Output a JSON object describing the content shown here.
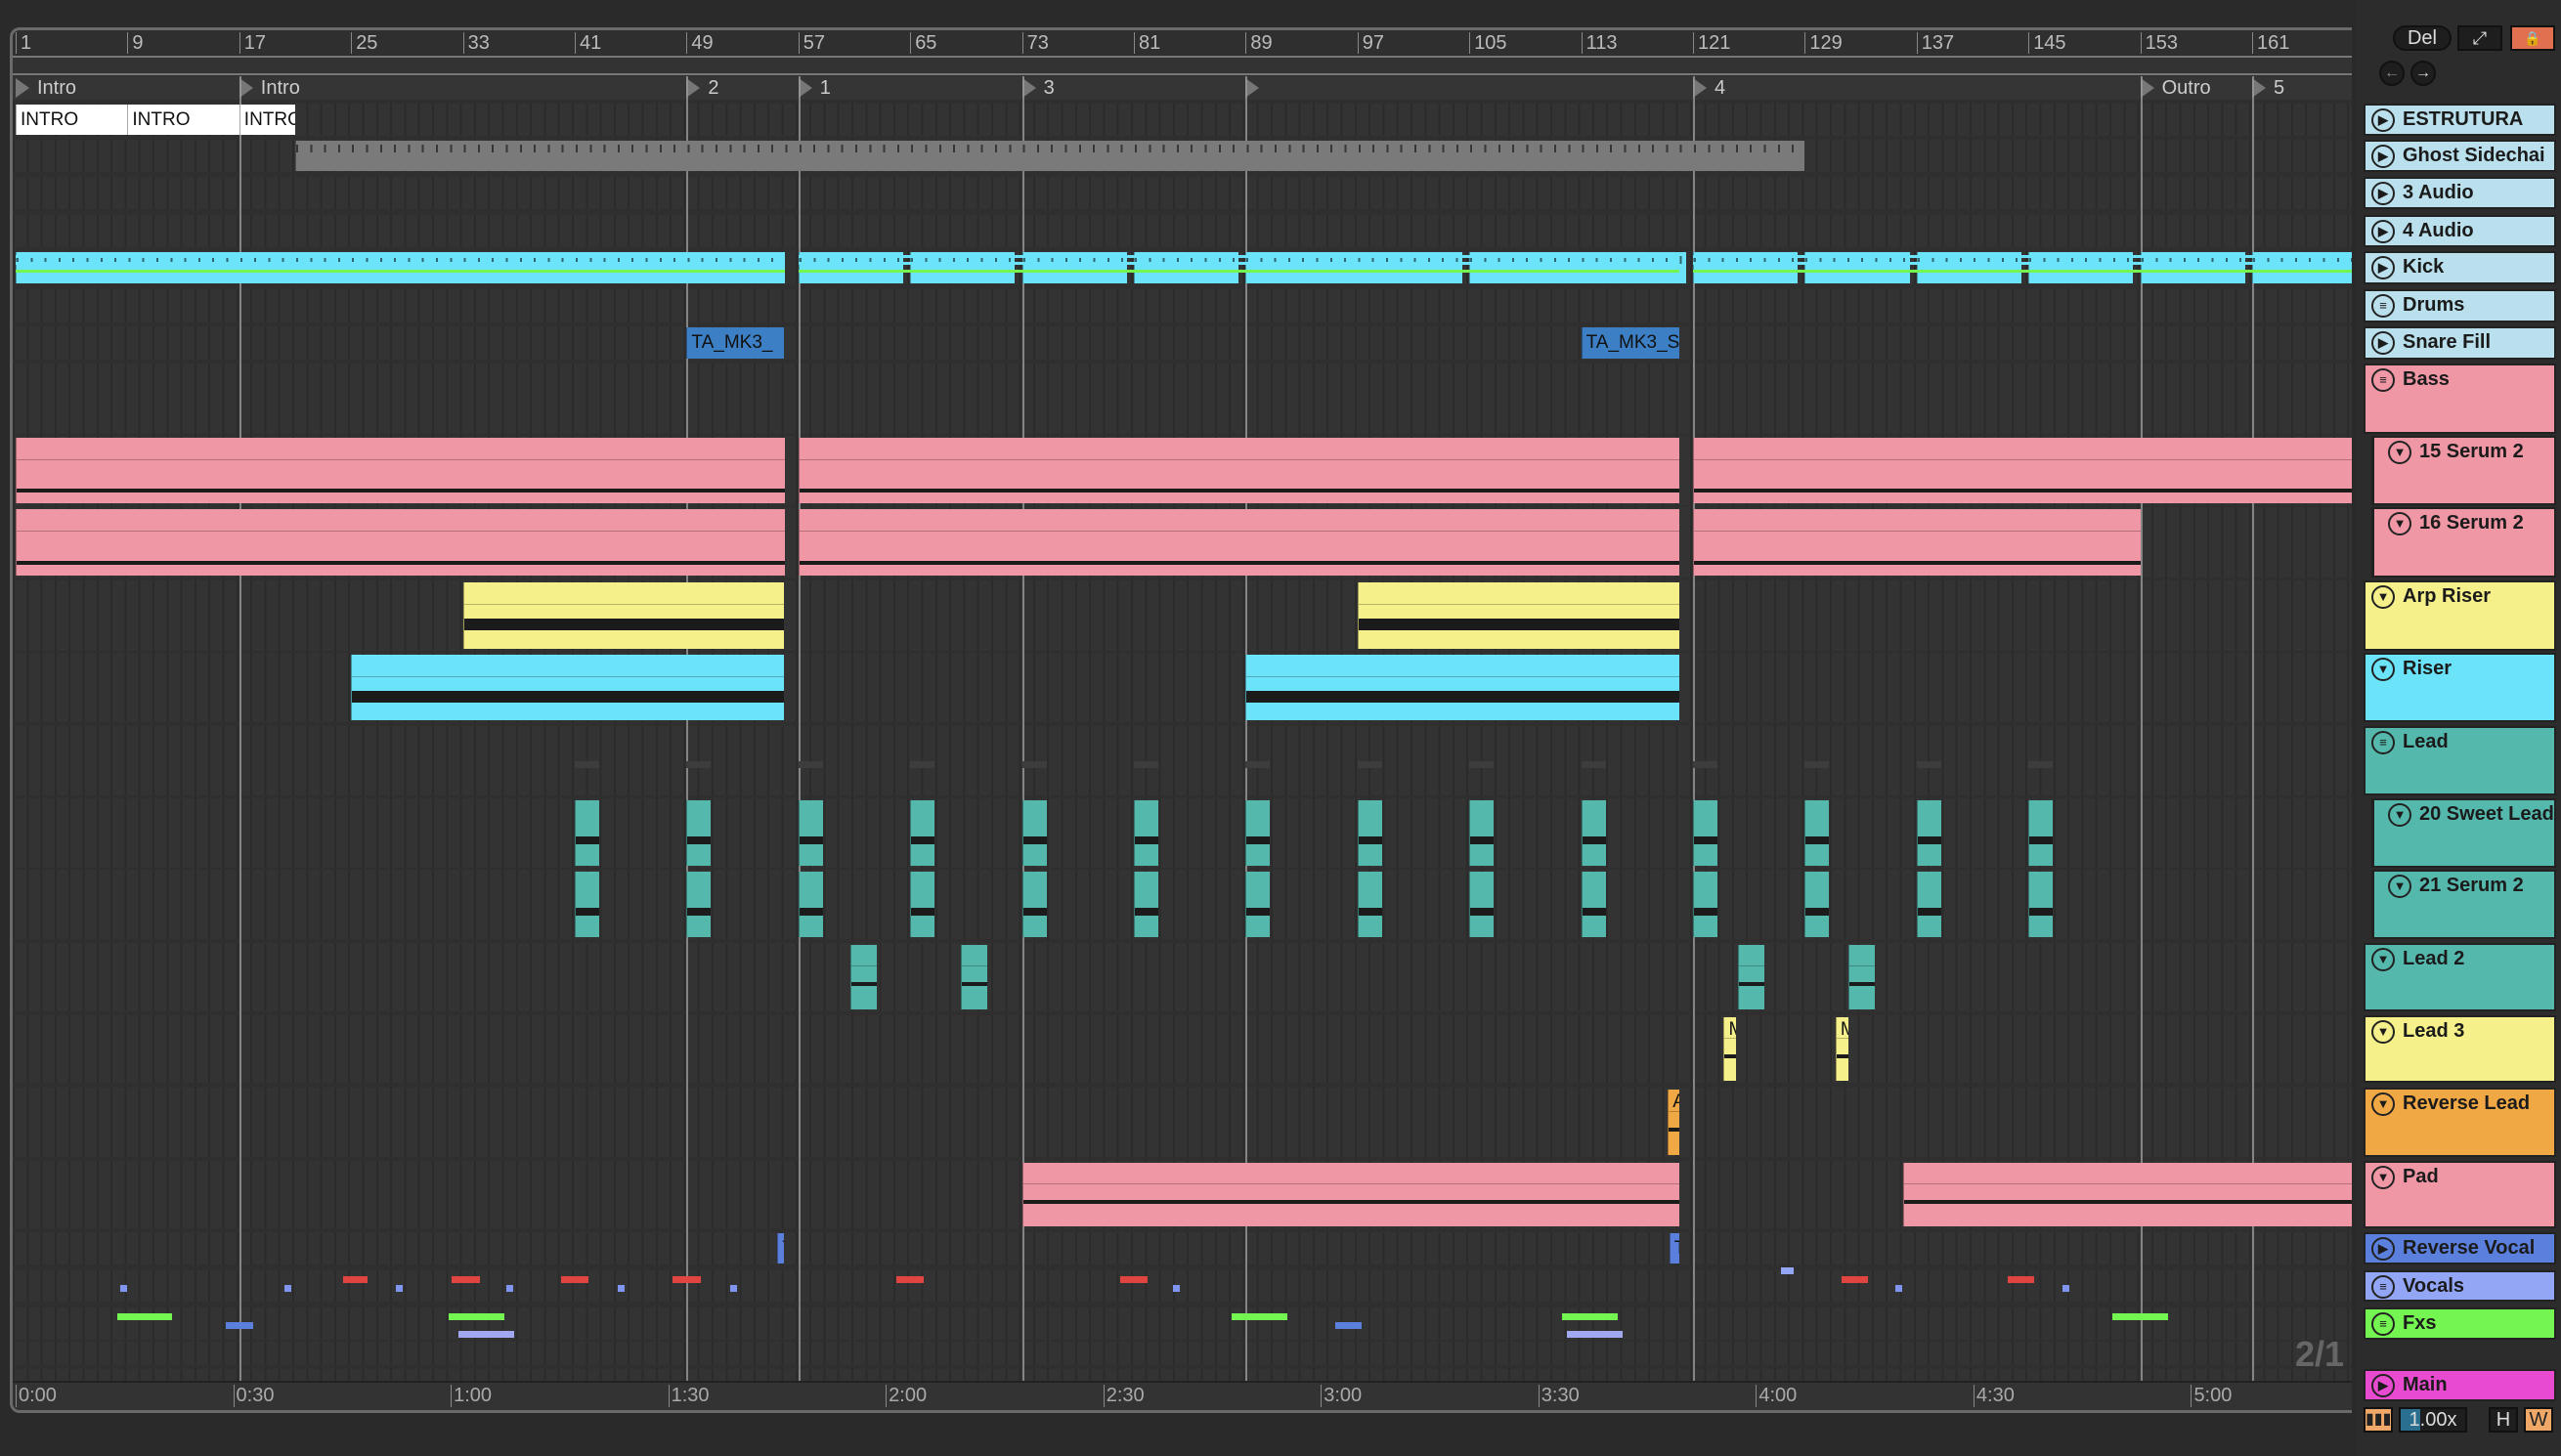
{
  "ruler": {
    "bars": [
      "1",
      "9",
      "17",
      "25",
      "33",
      "41",
      "49",
      "57",
      "65",
      "73",
      "81",
      "89",
      "97",
      "105",
      "113",
      "121",
      "129",
      "137",
      "145",
      "153",
      "161"
    ]
  },
  "locators": [
    {
      "label": "Intro",
      "bar": 1
    },
    {
      "label": "Intro",
      "bar": 17
    },
    {
      "label": "2",
      "bar": 49
    },
    {
      "label": "1",
      "bar": 57
    },
    {
      "label": "3",
      "bar": 73
    },
    {
      "label": "",
      "bar": 89
    },
    {
      "label": "4",
      "bar": 121
    },
    {
      "label": "Outro",
      "bar": 153
    },
    {
      "label": "5",
      "bar": 161
    }
  ],
  "tracks": [
    {
      "name": "ESTRUTURA",
      "color": "#b9e0ec",
      "icon": "play"
    },
    {
      "name": "Ghost Sidechai",
      "color": "#b9e0ec",
      "icon": "play"
    },
    {
      "name": "3 Audio",
      "color": "#b9e0ec",
      "icon": "play"
    },
    {
      "name": "4 Audio",
      "color": "#b9e0ec",
      "icon": "play"
    },
    {
      "name": "Kick",
      "color": "#b9e0ec",
      "icon": "play"
    },
    {
      "name": "Drums",
      "color": "#b9e0ec",
      "icon": "list"
    },
    {
      "name": "Snare Fill",
      "color": "#b9e0ec",
      "icon": "play"
    },
    {
      "name": "Bass",
      "color": "#f097a6",
      "icon": "group"
    },
    {
      "name": "15 Serum 2",
      "color": "#f097a6",
      "icon": "fold",
      "sub": true
    },
    {
      "name": "16 Serum 2",
      "color": "#f097a6",
      "icon": "fold",
      "sub": true
    },
    {
      "name": "Arp Riser",
      "color": "#f5f08a",
      "icon": "fold"
    },
    {
      "name": "Riser",
      "color": "#6be3f9",
      "icon": "fold"
    },
    {
      "name": "Lead",
      "color": "#55b8ad",
      "icon": "group"
    },
    {
      "name": "20 Sweet Lead",
      "color": "#55b8ad",
      "icon": "fold",
      "sub": true
    },
    {
      "name": "21 Serum 2",
      "color": "#55b8ad",
      "icon": "fold",
      "sub": true
    },
    {
      "name": "Lead 2",
      "color": "#55b8ad",
      "icon": "fold"
    },
    {
      "name": "Lead 3",
      "color": "#f5f08a",
      "icon": "fold"
    },
    {
      "name": "Reverse Lead",
      "color": "#f0a845",
      "icon": "fold"
    },
    {
      "name": "Pad",
      "color": "#f097a6",
      "icon": "fold"
    },
    {
      "name": "Reverse Vocal",
      "color": "#5b7fdc",
      "icon": "play"
    },
    {
      "name": "Vocals",
      "color": "#93a5f5",
      "icon": "list"
    },
    {
      "name": "Fxs",
      "color": "#75f552",
      "icon": "list"
    },
    {
      "name": "Main",
      "color": "#e84bd0",
      "icon": "play"
    }
  ],
  "clips": [
    {
      "track": 0,
      "start": 1,
      "end": 9,
      "label": "INTRO",
      "color": "#ffffff"
    },
    {
      "track": 0,
      "start": 9,
      "end": 17,
      "label": "INTRO",
      "color": "#ffffff"
    },
    {
      "track": 0,
      "start": 17,
      "end": 21,
      "label": "INTRO",
      "color": "#ffffff"
    },
    {
      "track": 1,
      "start": 21,
      "end": 129,
      "color": "#7a7a7a"
    },
    {
      "track": 4,
      "start": 1,
      "end": 56,
      "color": "#6be3f9"
    },
    {
      "track": 4,
      "start": 57,
      "end": 64.5,
      "color": "#6be3f9"
    },
    {
      "track": 4,
      "start": 65,
      "end": 72.5,
      "color": "#6be3f9"
    },
    {
      "track": 4,
      "start": 73,
      "end": 80.5,
      "color": "#6be3f9"
    },
    {
      "track": 4,
      "start": 81,
      "end": 88.5,
      "color": "#6be3f9"
    },
    {
      "track": 4,
      "start": 89,
      "end": 104.5,
      "color": "#6be3f9"
    },
    {
      "track": 4,
      "start": 105,
      "end": 120.5,
      "color": "#6be3f9"
    },
    {
      "track": 4,
      "start": 121,
      "end": 128.5,
      "color": "#6be3f9"
    },
    {
      "track": 4,
      "start": 129,
      "end": 136.5,
      "color": "#6be3f9"
    },
    {
      "track": 4,
      "start": 137,
      "end": 144.5,
      "color": "#6be3f9"
    },
    {
      "track": 4,
      "start": 145,
      "end": 152.5,
      "color": "#6be3f9"
    },
    {
      "track": 4,
      "start": 153,
      "end": 160.5,
      "color": "#6be3f9"
    },
    {
      "track": 4,
      "start": 161,
      "end": 168.5,
      "color": "#6be3f9"
    },
    {
      "track": 6,
      "start": 49,
      "end": 56,
      "label": "TA_MK3_",
      "color": "#3c7fc4"
    },
    {
      "track": 6,
      "start": 113,
      "end": 120,
      "label": "TA_MK3_S",
      "color": "#3c7fc4"
    },
    {
      "track": 8,
      "start": 1,
      "end": 56,
      "color": "#f097a6"
    },
    {
      "track": 8,
      "start": 57,
      "end": 120,
      "color": "#f097a6"
    },
    {
      "track": 8,
      "start": 121,
      "end": 169,
      "color": "#f097a6"
    },
    {
      "track": 9,
      "start": 1,
      "end": 56,
      "color": "#f097a6"
    },
    {
      "track": 9,
      "start": 57,
      "end": 120,
      "color": "#f097a6"
    },
    {
      "track": 9,
      "start": 121,
      "end": 153,
      "color": "#f097a6"
    },
    {
      "track": 10,
      "start": 33,
      "end": 56,
      "color": "#f5f08a"
    },
    {
      "track": 10,
      "start": 97,
      "end": 120,
      "color": "#f5f08a"
    },
    {
      "track": 11,
      "start": 25,
      "end": 56,
      "color": "#6be3f9"
    },
    {
      "track": 11,
      "start": 89,
      "end": 120,
      "color": "#6be3f9"
    },
    {
      "track": 15,
      "start": 60.7,
      "end": 62.6,
      "color": "#55b8ad"
    },
    {
      "track": 15,
      "start": 68.6,
      "end": 70.5,
      "color": "#55b8ad"
    },
    {
      "track": 15,
      "start": 124.2,
      "end": 126.1,
      "color": "#55b8ad"
    },
    {
      "track": 15,
      "start": 132.1,
      "end": 134,
      "color": "#55b8ad"
    },
    {
      "track": 16,
      "start": 123.2,
      "end": 124.1,
      "label": "M",
      "color": "#f5f08a"
    },
    {
      "track": 16,
      "start": 131.2,
      "end": 132.1,
      "label": "M",
      "color": "#f5f08a"
    },
    {
      "track": 17,
      "start": 119.2,
      "end": 120,
      "label": "A",
      "color": "#f0a845"
    },
    {
      "track": 18,
      "start": 73,
      "end": 120,
      "color": "#f097a6"
    },
    {
      "track": 18,
      "start": 136,
      "end": 169,
      "color": "#f097a6"
    },
    {
      "track": 19,
      "start": 55.5,
      "end": 56,
      "label": "T",
      "color": "#5b7fdc"
    },
    {
      "track": 19,
      "start": 119.3,
      "end": 120,
      "label": "T",
      "color": "#5b7fdc"
    }
  ],
  "lead_hits": [
    41,
    49,
    57,
    65,
    73,
    81,
    89,
    97,
    105,
    113,
    121,
    129,
    137,
    145
  ],
  "drum_lines": [
    {
      "start": 1,
      "end": 56
    },
    {
      "start": 57,
      "end": 120
    },
    {
      "start": 121,
      "end": 169
    }
  ],
  "fx_marks": [
    {
      "track": 20,
      "start": 24.4,
      "end": 26.2,
      "color": "#e0463f",
      "row": 0
    },
    {
      "track": 20,
      "start": 32.2,
      "end": 34.2,
      "color": "#e0463f",
      "row": 0
    },
    {
      "track": 20,
      "start": 40,
      "end": 42,
      "color": "#e0463f",
      "row": 0
    },
    {
      "track": 20,
      "start": 48,
      "end": 50,
      "color": "#e0463f",
      "row": 0
    },
    {
      "track": 20,
      "start": 64,
      "end": 66,
      "color": "#e0463f",
      "row": 0
    },
    {
      "track": 20,
      "start": 80,
      "end": 82,
      "color": "#e0463f",
      "row": 0
    },
    {
      "track": 20,
      "start": 131.6,
      "end": 133.5,
      "color": "#e0463f",
      "row": 0
    },
    {
      "track": 20,
      "start": 143.5,
      "end": 145.4,
      "color": "#e0463f",
      "row": 0
    },
    {
      "track": 20,
      "start": 8.5,
      "end": 9,
      "color": "#7f95f0",
      "row": 1
    },
    {
      "track": 20,
      "start": 20.2,
      "end": 20.7,
      "color": "#7f95f0",
      "row": 1
    },
    {
      "track": 20,
      "start": 28.2,
      "end": 28.7,
      "color": "#7f95f0",
      "row": 1
    },
    {
      "track": 20,
      "start": 36.1,
      "end": 36.6,
      "color": "#7f95f0",
      "row": 1
    },
    {
      "track": 20,
      "start": 44.1,
      "end": 44.6,
      "color": "#7f95f0",
      "row": 1
    },
    {
      "track": 20,
      "start": 52.1,
      "end": 52.6,
      "color": "#7f95f0",
      "row": 1
    },
    {
      "track": 20,
      "start": 83.8,
      "end": 84.3,
      "color": "#7f95f0",
      "row": 1
    },
    {
      "track": 20,
      "start": 135.5,
      "end": 136,
      "color": "#7f95f0",
      "row": 1
    },
    {
      "track": 20,
      "start": 147.4,
      "end": 147.9,
      "color": "#7f95f0",
      "row": 1
    },
    {
      "track": 20,
      "start": 127.3,
      "end": 128.2,
      "color": "#93a5f5",
      "row": -1
    },
    {
      "track": 21,
      "start": 8.3,
      "end": 12.2,
      "color": "#75f552",
      "row": 0
    },
    {
      "track": 21,
      "start": 32,
      "end": 36,
      "color": "#75f552",
      "row": 0
    },
    {
      "track": 21,
      "start": 88,
      "end": 92,
      "color": "#75f552",
      "row": 0
    },
    {
      "track": 21,
      "start": 111.6,
      "end": 115.6,
      "color": "#75f552",
      "row": 0
    },
    {
      "track": 21,
      "start": 151,
      "end": 155,
      "color": "#75f552",
      "row": 0
    },
    {
      "track": 21,
      "start": 16,
      "end": 18,
      "color": "#5b7fdc",
      "row": 1
    },
    {
      "track": 21,
      "start": 95.4,
      "end": 97.3,
      "color": "#5b7fdc",
      "row": 1
    },
    {
      "track": 21,
      "start": 32.7,
      "end": 36.7,
      "color": "#a2a8f0",
      "row": 2
    },
    {
      "track": 21,
      "start": 112,
      "end": 116,
      "color": "#a2a8f0",
      "row": 2
    }
  ],
  "locator_lines": [
    17,
    49,
    57,
    73,
    89,
    121,
    153,
    161
  ],
  "time_ruler": [
    "0:00",
    "0:30",
    "1:00",
    "1:30",
    "2:00",
    "2:30",
    "3:00",
    "3:30",
    "4:00",
    "4:30",
    "5:00"
  ],
  "grid_indicator": "2/1",
  "controls": {
    "delete": "Del",
    "expand_icon": "⤢",
    "lock_icon": "🔒",
    "back_icon": "←",
    "forward_icon": "→",
    "tempo_follow_icon": "waveform",
    "zoom_value": "1.00x",
    "h_label": "H",
    "w_label": "W"
  },
  "colors": {
    "accent": "#f0a868",
    "lock": "#e07050"
  }
}
